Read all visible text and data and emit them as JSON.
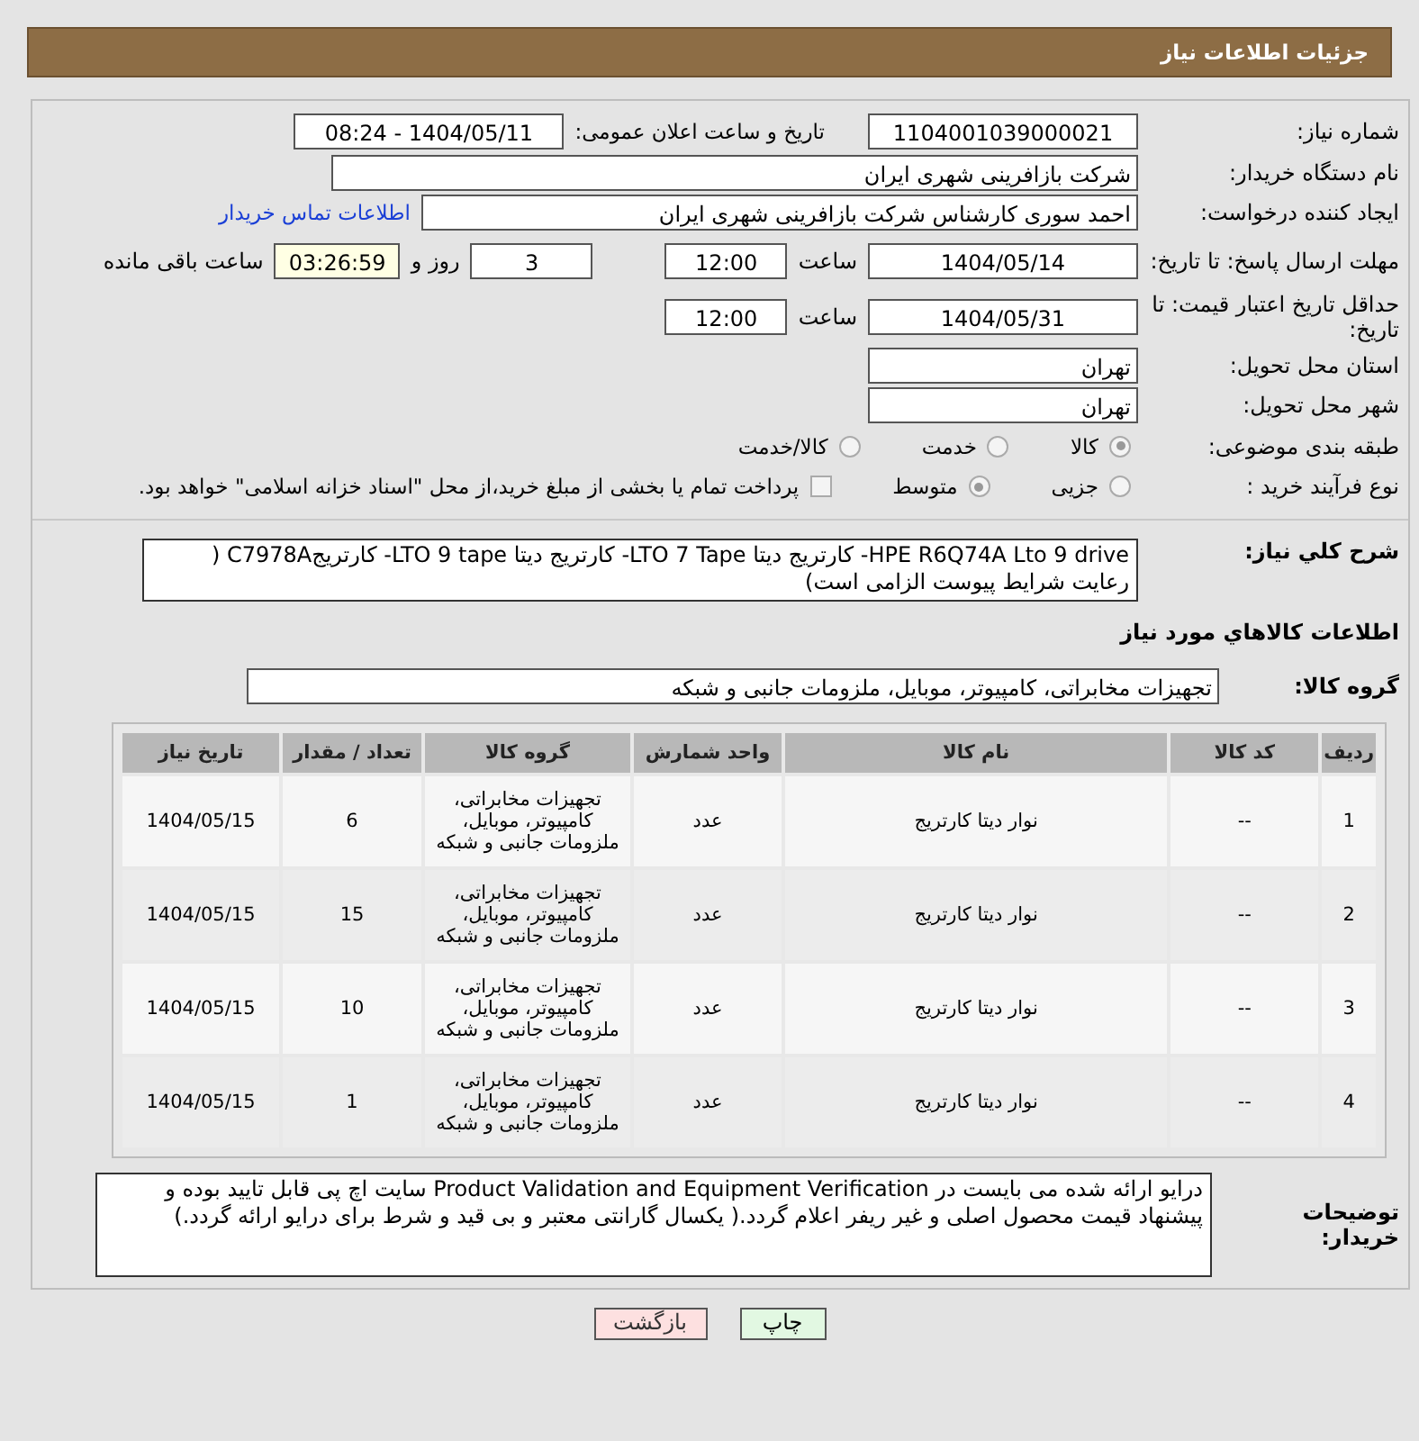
{
  "title": "جزئیات اطلاعات نیاز",
  "need_number": {
    "label": "شماره نیاز:",
    "value": "1104001039000021"
  },
  "announce": {
    "label": "تاریخ و ساعت اعلان عمومی:",
    "value": "1404/05/11 - 08:24"
  },
  "buyer_org": {
    "label": "نام دستگاه خریدار:",
    "value": "شرکت بازافرینی شهری ایران"
  },
  "requester": {
    "label": "ایجاد کننده درخواست:",
    "value": "احمد سوری کارشناس شرکت بازافرینی شهری ایران",
    "link": "اطلاعات تماس خریدار"
  },
  "reply_deadline": {
    "label": "مهلت ارسال پاسخ: تا تاریخ:",
    "date": "1404/05/14",
    "time_label": "ساعت",
    "time": "12:00",
    "days": "3",
    "days_label": "روز و",
    "remaining": "03:26:59",
    "remaining_label": "ساعت باقی مانده"
  },
  "price_validity": {
    "label": "حداقل تاریخ اعتبار قیمت: تا تاریخ:",
    "date": "1404/05/31",
    "time_label": "ساعت",
    "time": "12:00"
  },
  "province": {
    "label": "استان محل تحویل:",
    "value": "تهران"
  },
  "city": {
    "label": "شهر محل تحویل:",
    "value": "تهران"
  },
  "category": {
    "label": "طبقه بندی موضوعی:",
    "options": [
      {
        "label": "کالا",
        "selected": true
      },
      {
        "label": "خدمت",
        "selected": false
      },
      {
        "label": "کالا/خدمت",
        "selected": false
      }
    ]
  },
  "process": {
    "label": "نوع فرآیند خرید :",
    "options": [
      {
        "label": "جزیی",
        "selected": false
      },
      {
        "label": "متوسط",
        "selected": true
      }
    ],
    "treasury": {
      "label": "پرداخت تمام یا بخشی از مبلغ خرید،از محل \"اسناد خزانه اسلامی\" خواهد بود.",
      "checked": false
    }
  },
  "description": {
    "label": "شرح کلي نياز:",
    "value": "HPE R6Q74A Lto 9 drive- کارتریج دیتا LTO 7 Tape- کارتریج دیتا LTO 9 tape- کارتریجC7978A ( رعایت شرایط پیوست الزامی است)"
  },
  "goods_heading": "اطلاعات کالاهاي مورد نياز",
  "goods_group": {
    "label": "گروه کالا:",
    "value": "تجهیزات مخابراتی، کامپیوتر، موبایل، ملزومات جانبی و شبکه"
  },
  "table": {
    "columns": [
      "ردیف",
      "کد کالا",
      "نام کالا",
      "واحد شمارش",
      "گروه کالا",
      "تعداد / مقدار",
      "تاریخ نیاز"
    ],
    "rows": [
      [
        "1",
        "--",
        "نوار دیتا کارتریج",
        "عدد",
        "تجهیزات مخابراتی، کامپیوتر، موبایل، ملزومات جانبی و شبکه",
        "6",
        "1404/05/15"
      ],
      [
        "2",
        "--",
        "نوار دیتا کارتریج",
        "عدد",
        "تجهیزات مخابراتی، کامپیوتر، موبایل، ملزومات جانبی و شبکه",
        "15",
        "1404/05/15"
      ],
      [
        "3",
        "--",
        "نوار دیتا کارتریج",
        "عدد",
        "تجهیزات مخابراتی، کامپیوتر، موبایل، ملزومات جانبی و شبکه",
        "10",
        "1404/05/15"
      ],
      [
        "4",
        "--",
        "نوار دیتا کارتریج",
        "عدد",
        "تجهیزات مخابراتی، کامپیوتر، موبایل، ملزومات جانبی و شبکه",
        "1",
        "1404/05/15"
      ]
    ]
  },
  "buyer_notes": {
    "label": "توضیحات خریدار:",
    "value": "درایو ارائه شده می بایست در  Product Validation and Equipment Verification سایت اچ پی قابل تایید بوده و پیشنهاد قیمت محصول اصلی و غیر ریفر اعلام گردد.( یکسال گارانتی معتبر و بی قید و شرط برای درایو ارائه گردد.)"
  },
  "buttons": [
    {
      "label": "چاپ",
      "kind": "print"
    },
    {
      "label": "بازگشت",
      "kind": "back"
    }
  ]
}
